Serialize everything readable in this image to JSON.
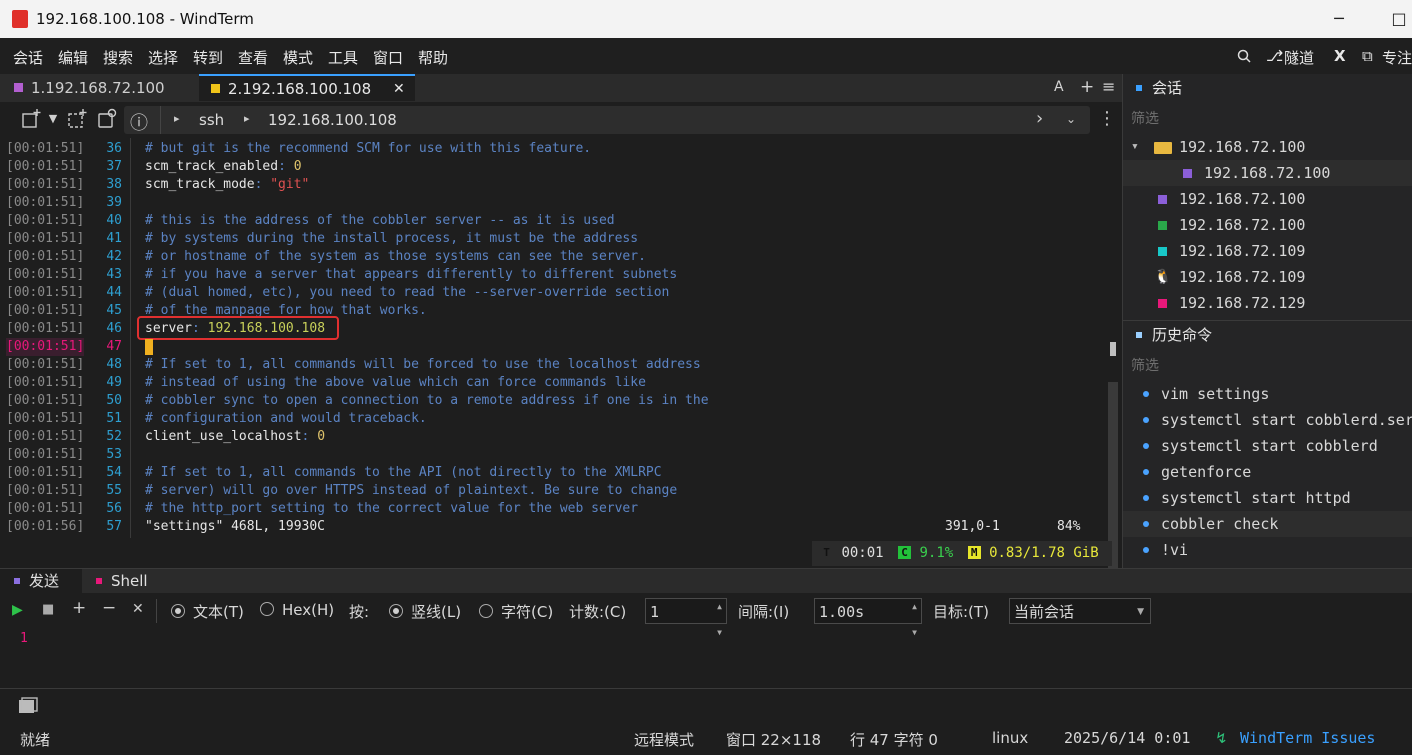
{
  "window": {
    "title": "192.168.100.108 - WindTerm",
    "minimize": "─",
    "maximize": "□"
  },
  "menu": [
    "会话",
    "编辑",
    "搜索",
    "选择",
    "转到",
    "查看",
    "模式",
    "工具",
    "窗口",
    "帮助"
  ],
  "menu_right": {
    "tunnel": "隧道",
    "focus": "专注"
  },
  "tabs": [
    {
      "label": "1.192.168.72.100",
      "color": "#b25fd0"
    },
    {
      "label": "2.192.168.100.108",
      "color": "#f0c419",
      "close": "✕"
    }
  ],
  "tab_actions": {
    "font": "A",
    "add": "+",
    "menu": "≡"
  },
  "address": {
    "protocol": "ssh",
    "host": "192.168.100.108",
    "info": "ⓘ"
  },
  "terminal": {
    "lines": [
      {
        "ts": "[00:01:51]",
        "ln": "36",
        "parts": [
          {
            "c": "cmt",
            "t": "# but git is the recommend SCM for use with this feature."
          }
        ]
      },
      {
        "ts": "[00:01:51]",
        "ln": "37",
        "parts": [
          {
            "c": "key",
            "t": "scm_track_enabled"
          },
          {
            "c": "cmt",
            "t": ": "
          },
          {
            "c": "num",
            "t": "0"
          }
        ]
      },
      {
        "ts": "[00:01:51]",
        "ln": "38",
        "parts": [
          {
            "c": "key",
            "t": "scm_track_mode"
          },
          {
            "c": "cmt",
            "t": ": "
          },
          {
            "c": "str",
            "t": "\"git\""
          }
        ]
      },
      {
        "ts": "[00:01:51]",
        "ln": "39",
        "parts": []
      },
      {
        "ts": "[00:01:51]",
        "ln": "40",
        "parts": [
          {
            "c": "cmt",
            "t": "# this is the address of the cobbler server -- as it is used"
          }
        ]
      },
      {
        "ts": "[00:01:51]",
        "ln": "41",
        "parts": [
          {
            "c": "cmt",
            "t": "# by systems during the install process, it must be the address"
          }
        ]
      },
      {
        "ts": "[00:01:51]",
        "ln": "42",
        "parts": [
          {
            "c": "cmt",
            "t": "# or hostname of the system as those systems can see the server."
          }
        ]
      },
      {
        "ts": "[00:01:51]",
        "ln": "43",
        "parts": [
          {
            "c": "cmt",
            "t": "# if you have a server that appears differently to different subnets"
          }
        ]
      },
      {
        "ts": "[00:01:51]",
        "ln": "44",
        "parts": [
          {
            "c": "cmt",
            "t": "# (dual homed, etc), you need to read the --server-override section"
          }
        ]
      },
      {
        "ts": "[00:01:51]",
        "ln": "45",
        "parts": [
          {
            "c": "cmt",
            "t": "# of the manpage for how that works."
          }
        ]
      },
      {
        "ts": "[00:01:51]",
        "ln": "46",
        "parts": [
          {
            "c": "key",
            "t": "server"
          },
          {
            "c": "cmt",
            "t": ": "
          },
          {
            "c": "ip",
            "t": "192.168.100.108"
          }
        ]
      },
      {
        "ts": "[00:01:51]",
        "ln": "47",
        "parts": [],
        "current": true
      },
      {
        "ts": "[00:01:51]",
        "ln": "48",
        "parts": [
          {
            "c": "cmt",
            "t": "# If set to 1, all commands will be forced to use the localhost address"
          }
        ]
      },
      {
        "ts": "[00:01:51]",
        "ln": "49",
        "parts": [
          {
            "c": "cmt",
            "t": "# instead of using the above value which can force commands like"
          }
        ]
      },
      {
        "ts": "[00:01:51]",
        "ln": "50",
        "parts": [
          {
            "c": "cmt",
            "t": "# cobbler sync to open a connection to a remote address if one is in the"
          }
        ]
      },
      {
        "ts": "[00:01:51]",
        "ln": "51",
        "parts": [
          {
            "c": "cmt",
            "t": "# configuration and would traceback."
          }
        ]
      },
      {
        "ts": "[00:01:51]",
        "ln": "52",
        "parts": [
          {
            "c": "key",
            "t": "client_use_localhost"
          },
          {
            "c": "cmt",
            "t": ": "
          },
          {
            "c": "num",
            "t": "0"
          }
        ]
      },
      {
        "ts": "[00:01:51]",
        "ln": "53",
        "parts": []
      },
      {
        "ts": "[00:01:51]",
        "ln": "54",
        "parts": [
          {
            "c": "cmt",
            "t": "# If set to 1, all commands to the API (not directly to the XMLRPC"
          }
        ]
      },
      {
        "ts": "[00:01:51]",
        "ln": "55",
        "parts": [
          {
            "c": "cmt",
            "t": "# server) will go over HTTPS instead of plaintext. Be sure to change"
          }
        ]
      },
      {
        "ts": "[00:01:51]",
        "ln": "56",
        "parts": [
          {
            "c": "cmt",
            "t": "# the http_port setting to the correct value for the web server"
          }
        ]
      },
      {
        "ts": "[00:01:56]",
        "ln": "57",
        "parts": [
          {
            "c": "key",
            "t": "\"settings\" 468L, 19930C"
          }
        ]
      }
    ],
    "vim_pos": "391,0-1",
    "vim_pct": "84%"
  },
  "stats": {
    "time": "00:01",
    "cpu": "9.1%",
    "mem": "0.83/1.78 GiB",
    "t": "T",
    "c": "C",
    "m": "M"
  },
  "sessions": {
    "title": "会话",
    "filter": "筛选",
    "items": [
      {
        "label": "192.168.72.100",
        "color": "#e8b840",
        "type": "folder"
      },
      {
        "label": "192.168.72.100",
        "color": "#8b5fd8",
        "type": "child"
      },
      {
        "label": "192.168.72.100",
        "color": "#8b5fd8",
        "type": "item"
      },
      {
        "label": "192.168.72.100",
        "color": "#2aa84a",
        "type": "item"
      },
      {
        "label": "192.168.72.109",
        "color": "#18c8c8",
        "type": "item"
      },
      {
        "label": "192.168.72.109",
        "color": "#e6c04a",
        "type": "linux"
      },
      {
        "label": "192.168.72.129",
        "color": "#e8187a",
        "type": "item"
      }
    ]
  },
  "history": {
    "title": "历史命令",
    "filter": "筛选",
    "items": [
      "vim settings",
      "systemctl start cobblerd.ser",
      "systemctl start cobblerd",
      "getenforce",
      "systemctl start httpd",
      "cobbler check",
      "!vi"
    ]
  },
  "send": {
    "tabs": [
      "发送",
      "Shell"
    ],
    "mode_text": "文本(T)",
    "mode_hex": "Hex(H)",
    "by": "按:",
    "by_line": "竖线(L)",
    "by_char": "字符(C)",
    "count_label": "计数:(C)",
    "count_value": "1",
    "interval_label": "间隔:(I)",
    "interval_value": "1.00s",
    "target_label": "目标:(T)",
    "target_value": "当前会话",
    "editor_line": "1"
  },
  "status": {
    "ready": "就绪",
    "mode": "远程模式",
    "window": "窗口 22×118",
    "cursor": "行 47 字符 0",
    "os": "linux",
    "datetime": "2025/6/14 0:01",
    "issues": "WindTerm Issues"
  }
}
